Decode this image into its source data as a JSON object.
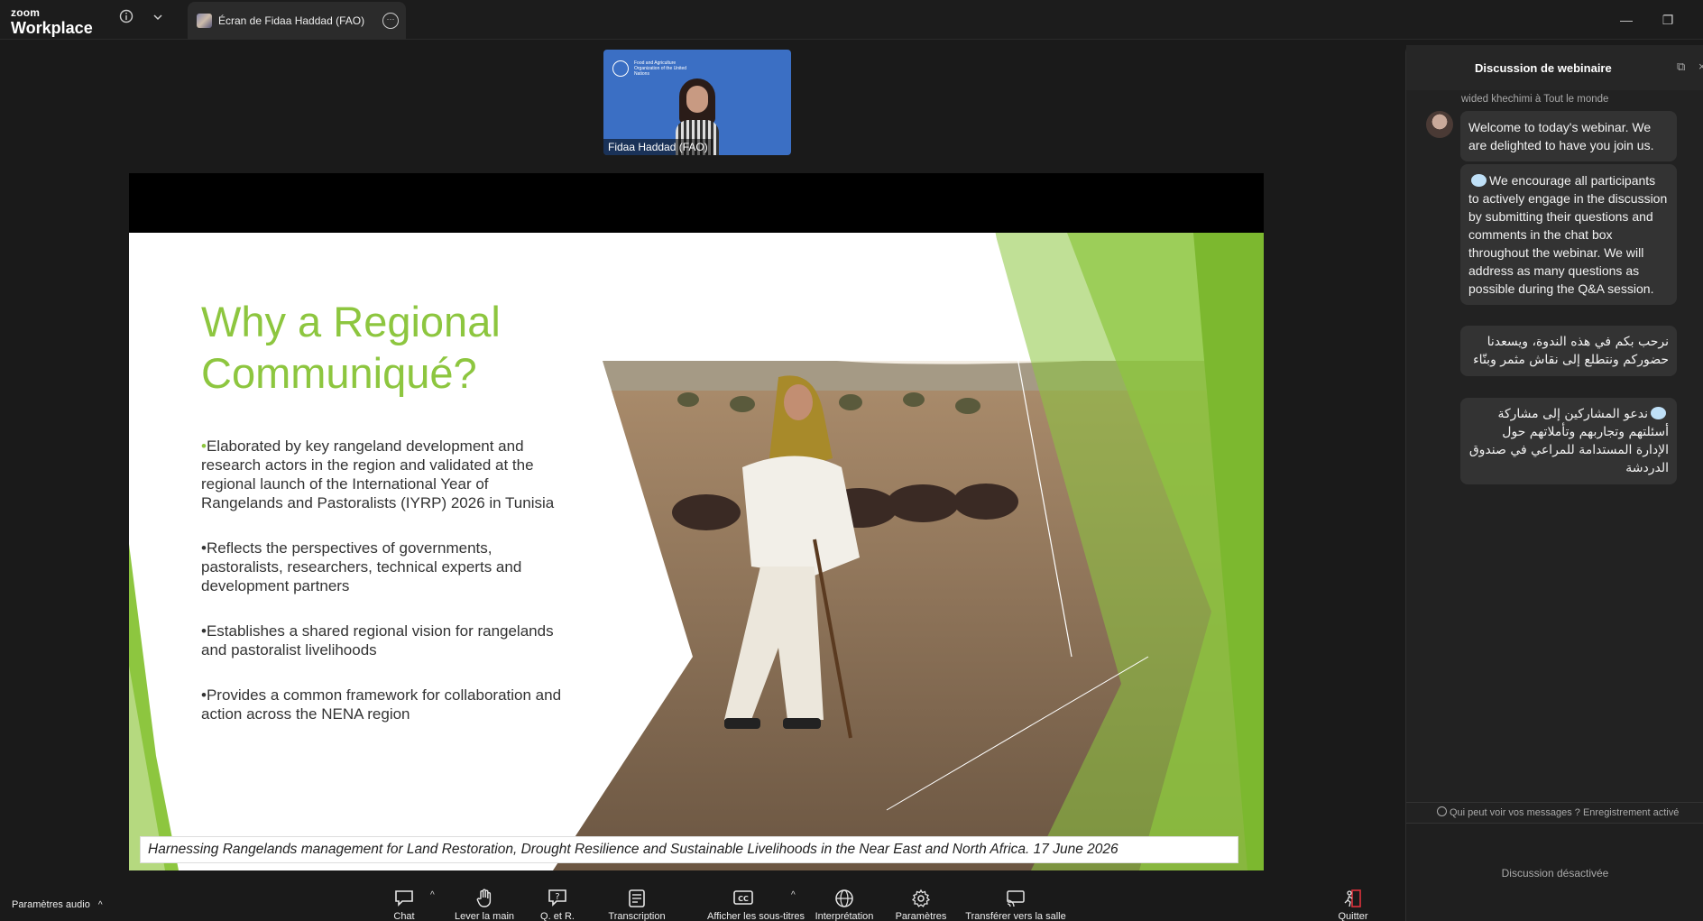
{
  "titlebar": {
    "brand_top": "zoom",
    "brand_bottom": "Workplace",
    "info_icon": "i",
    "dropdown_icon": "⌄",
    "tab_label": "Écran de Fidaa Haddad (FAO)",
    "tab_more_icon": "···",
    "minimize_icon": "—",
    "restore_icon": "❐"
  },
  "video": {
    "org_name": "Food and Agriculture Organization of the United Nations",
    "participant_name": "Fidaa Haddad (FAO)"
  },
  "slide": {
    "title": "Why a Regional Communiqué?",
    "bullets": [
      "Elaborated by key rangeland development and research actors in the region and validated at the regional launch of the International Year of Rangelands and Pastoralists (IYRP) 2026 in Tunisia",
      "Reflects the perspectives of governments, pastoralists, researchers, technical experts and development partners",
      "Establishes a shared regional vision for rangelands and pastoralist livelihoods",
      "Provides a common framework for collaboration and action across the NENA region"
    ],
    "bullet_mark": "•",
    "footer": "Harnessing Rangelands management for Land Restoration, Drought Resilience and Sustainable Livelihoods in the Near East and North Africa. 17 June 2026",
    "accent_color": "#8dc63f"
  },
  "chat": {
    "title": "Discussion de webinaire",
    "popout_icon": "⧉",
    "close_icon": "×",
    "sender": "wided khechimi à Tout le monde",
    "messages": [
      "Welcome to today's webinar. We are delighted to have you join us.",
      "We encourage all participants to actively engage in the discussion by submitting their questions and comments in the chat box throughout the webinar. We will address as many questions as possible during the Q&A session.",
      "نرحب بكم في هذه الندوة، ويسعدنا حضوركم ونتطلع إلى نقاش مثمر وبنّاء",
      "ندعو المشاركين إلى مشاركة أسئلتهم وتجاربهم وتأملاتهم حول الإدارة المستدامة للمراعي في صندوق الدردشة"
    ],
    "privacy_text": "Qui peut voir vos messages ? Enregistrement activé",
    "disabled_text": "Discussion désactivée"
  },
  "toolbar": {
    "audio_settings": "Paramètres audio",
    "caret": "^",
    "items": [
      {
        "label": "Chat",
        "icon": "chat-icon"
      },
      {
        "label": "Lever la main",
        "icon": "raise-hand-icon"
      },
      {
        "label": "Q. et R.",
        "icon": "qa-icon"
      },
      {
        "label": "Transcription",
        "icon": "transcription-icon"
      },
      {
        "label": "Afficher les sous-titres",
        "icon": "captions-icon"
      },
      {
        "label": "Interprétation",
        "icon": "globe-icon"
      },
      {
        "label": "Paramètres",
        "icon": "gear-icon"
      },
      {
        "label": "Transférer vers la salle",
        "icon": "cast-icon"
      },
      {
        "label": "Quitter",
        "icon": "leave-icon"
      }
    ],
    "glyphs": {
      "chat": "💬",
      "raise_hand": "✋",
      "qa": "?",
      "transcription": "☰",
      "captions": "CC",
      "globe": "🌐",
      "gear": "⚙",
      "cast": "⎚",
      "leave": "⏏"
    }
  }
}
